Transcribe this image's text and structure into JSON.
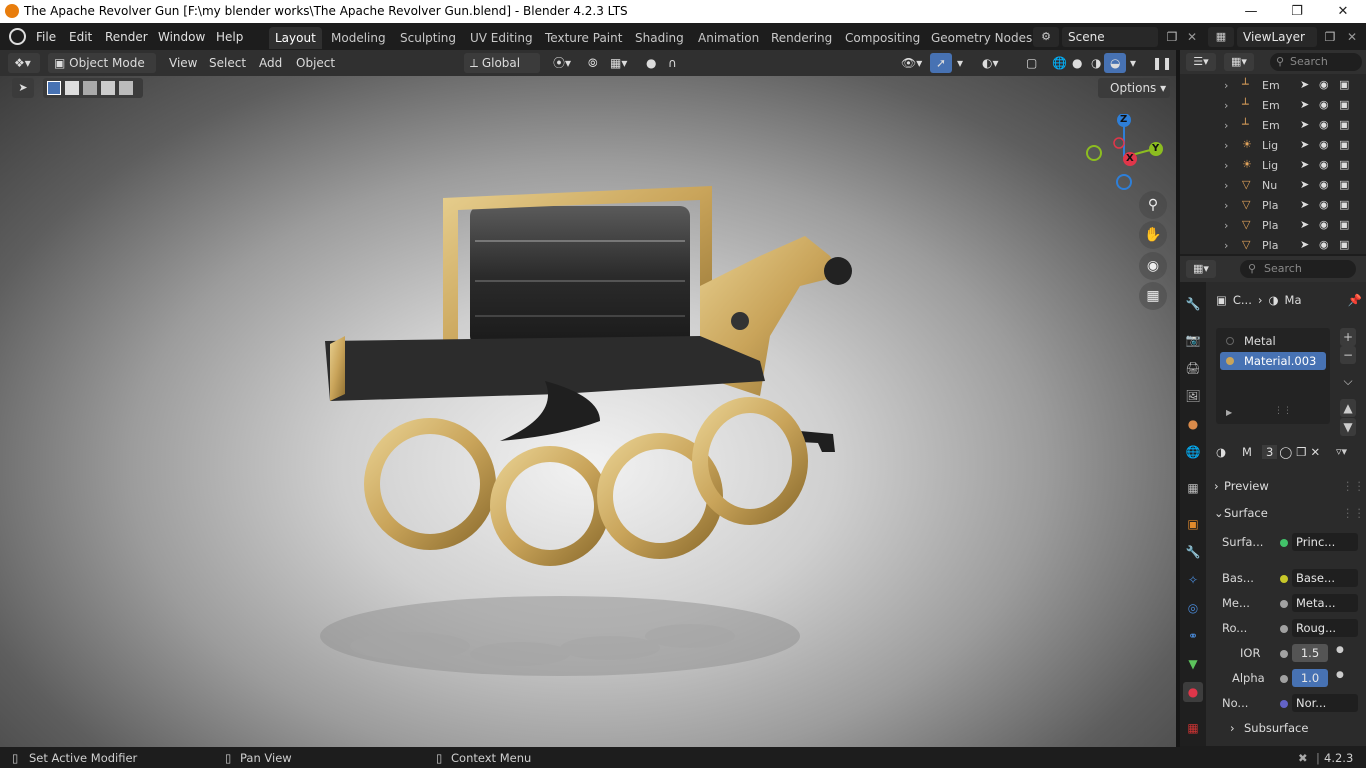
{
  "window": {
    "title": "The Apache Revolver Gun [F:\\my blender works\\The Apache Revolver Gun.blend] - Blender 4.2.3 LTS"
  },
  "menu": [
    "File",
    "Edit",
    "Render",
    "Window",
    "Help"
  ],
  "workspaces": [
    "Layout",
    "Modeling",
    "Sculpting",
    "UV Editing",
    "Texture Paint",
    "Shading",
    "Animation",
    "Rendering",
    "Compositing",
    "Geometry Nodes"
  ],
  "active_workspace": "Layout",
  "scene": {
    "name": "Scene"
  },
  "view_layer": {
    "name": "ViewLayer"
  },
  "viewport_header": {
    "mode": "Object Mode",
    "view": "View",
    "select": "Select",
    "add": "Add",
    "object": "Object",
    "orientation": "Global",
    "options": "Options"
  },
  "gizmo": {
    "z": "Z",
    "y": "Y",
    "x": "X"
  },
  "outliner": {
    "search_placeholder": "Search",
    "rows": [
      {
        "label": "Em",
        "icon": "empty-icon"
      },
      {
        "label": "Em",
        "icon": "empty-icon"
      },
      {
        "label": "Em",
        "icon": "empty-icon"
      },
      {
        "label": "Lig",
        "icon": "light-icon"
      },
      {
        "label": "Lig",
        "icon": "light-icon"
      },
      {
        "label": "Nu",
        "icon": "mesh-icon"
      },
      {
        "label": "Pla",
        "icon": "mesh-icon"
      },
      {
        "label": "Pla",
        "icon": "mesh-icon"
      },
      {
        "label": "Pla",
        "icon": "mesh-icon"
      }
    ]
  },
  "properties": {
    "search_placeholder": "Search",
    "breadcrumb": {
      "object": "C...",
      "material": "Ma"
    },
    "material_slots": [
      "Metal",
      "Material.003"
    ],
    "active_slot": "Material.003",
    "material_name": "M",
    "user_count": "3",
    "panels": {
      "preview": "Preview",
      "surface": "Surface",
      "subsurface": "Subsurface"
    },
    "surface": {
      "surface_label": "Surfa...",
      "surface_value": "Princ...",
      "base_label": "Bas...",
      "base_value": "Base...",
      "metal_label": "Me...",
      "metal_value": "Meta...",
      "rough_label": "Ro...",
      "rough_value": "Roug...",
      "ior_label": "IOR",
      "ior_value": "1.5",
      "alpha_label": "Alpha",
      "alpha_value": "1.0",
      "normal_label": "No...",
      "normal_value": "Nor..."
    }
  },
  "statusbar": {
    "left": "Set Active Modifier",
    "middle": "Pan View",
    "right": "Context Menu",
    "version": "4.2.3"
  },
  "colors": {
    "accent": "#4772b3",
    "axis_x": "#e0364a",
    "axis_y": "#8cbd20",
    "axis_z": "#2e7fd8",
    "brass": "#c9a45a"
  }
}
